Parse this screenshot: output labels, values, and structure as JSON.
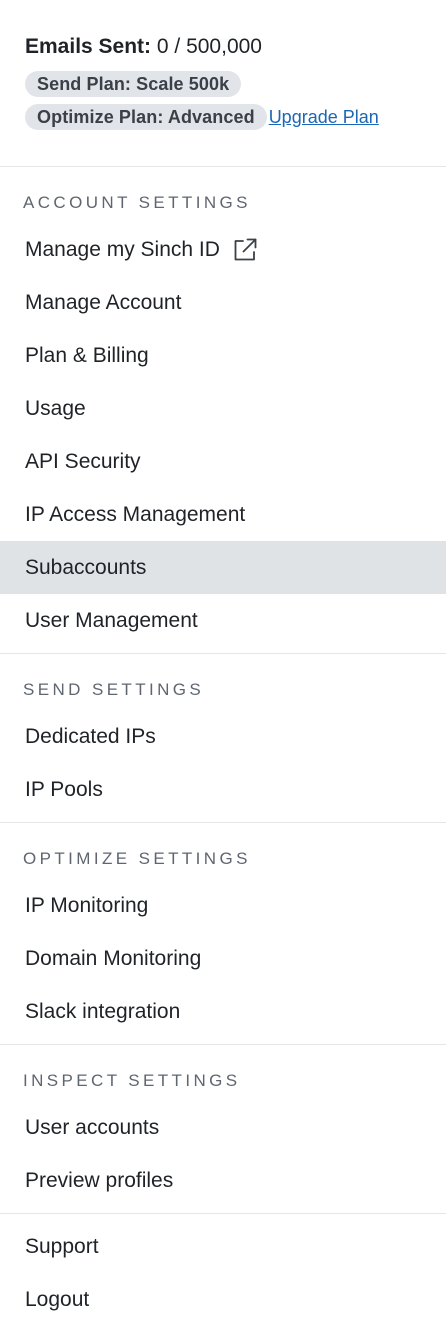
{
  "summary": {
    "emails_sent_label": "Emails Sent:",
    "emails_sent_value": "0 / 500,000",
    "send_plan": "Send Plan: Scale 500k",
    "optimize_plan": "Optimize Plan: Advanced",
    "upgrade_link": "Upgrade Plan"
  },
  "account_settings": {
    "heading": "ACCOUNT SETTINGS",
    "items": [
      {
        "label": "Manage my Sinch ID",
        "icon": "external-link-icon"
      },
      {
        "label": "Manage Account"
      },
      {
        "label": "Plan & Billing"
      },
      {
        "label": "Usage"
      },
      {
        "label": "API Security"
      },
      {
        "label": "IP Access Management"
      },
      {
        "label": "Subaccounts",
        "active": true
      },
      {
        "label": "User Management"
      }
    ]
  },
  "send_settings": {
    "heading": "SEND SETTINGS",
    "items": [
      {
        "label": "Dedicated IPs"
      },
      {
        "label": "IP Pools"
      }
    ]
  },
  "optimize_settings": {
    "heading": "OPTIMIZE SETTINGS",
    "items": [
      {
        "label": "IP Monitoring"
      },
      {
        "label": "Domain Monitoring"
      },
      {
        "label": "Slack integration"
      }
    ]
  },
  "inspect_settings": {
    "heading": "INSPECT SETTINGS",
    "items": [
      {
        "label": "User accounts"
      },
      {
        "label": "Preview profiles"
      }
    ]
  },
  "footer": {
    "items": [
      {
        "label": "Support"
      },
      {
        "label": "Logout"
      }
    ]
  },
  "colors": {
    "active_bg": "#dfe3e6",
    "badge_bg": "#e1e5e9",
    "link": "#1b67b6",
    "divider": "#e4e7ea",
    "heading": "#5f6670"
  }
}
